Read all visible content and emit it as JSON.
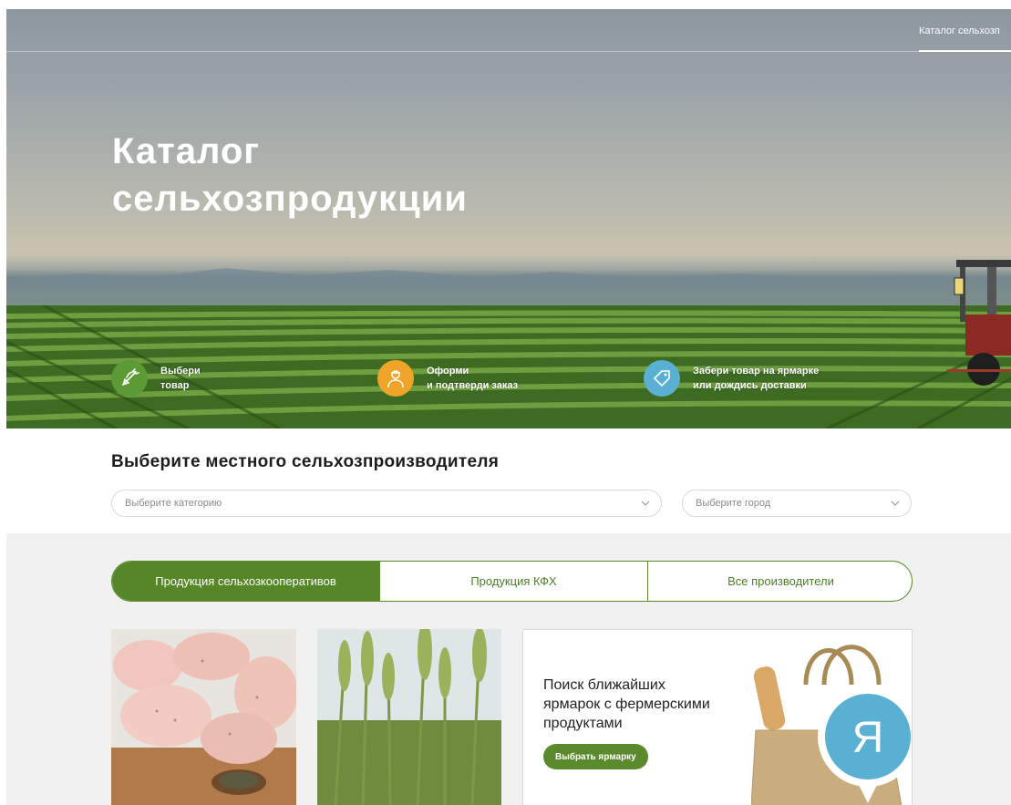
{
  "header": {
    "nav_link": "Каталог сельхозп"
  },
  "hero": {
    "title_line1": "Каталог",
    "title_line2": "сельхозпродукции",
    "steps": [
      {
        "icon": "carrot-icon",
        "line1": "Выбери",
        "line2": "товар",
        "color": "#5b9a35"
      },
      {
        "icon": "farmer-icon",
        "line1": "Оформи",
        "line2": "и подтверди заказ",
        "color": "#f0a52a"
      },
      {
        "icon": "tag-icon",
        "line1": "Забери товар на ярмарке",
        "line2": "или дождись доставки",
        "color": "#5ab0d3"
      }
    ]
  },
  "filters": {
    "title": "Выберите местного сельхозпроизводителя",
    "category_placeholder": "Выберите категорию",
    "city_placeholder": "Выберите город"
  },
  "tabs": [
    {
      "label": "Продукция сельхозкооперативов",
      "active": true
    },
    {
      "label": "Продукция КФХ",
      "active": false
    },
    {
      "label": "Все производители",
      "active": false
    }
  ],
  "cards": [
    {
      "image": "chicken-fillet-photo"
    },
    {
      "image": "wheat-photo"
    }
  ],
  "promo": {
    "line1": "Поиск ближайших",
    "line2": "ярмарок с фермерскими",
    "line3": "продуктами",
    "button": "Выбрать ярмарку",
    "badge_letter": "Я"
  },
  "colors": {
    "accent": "#578629",
    "badge": "#5ab0d3"
  }
}
